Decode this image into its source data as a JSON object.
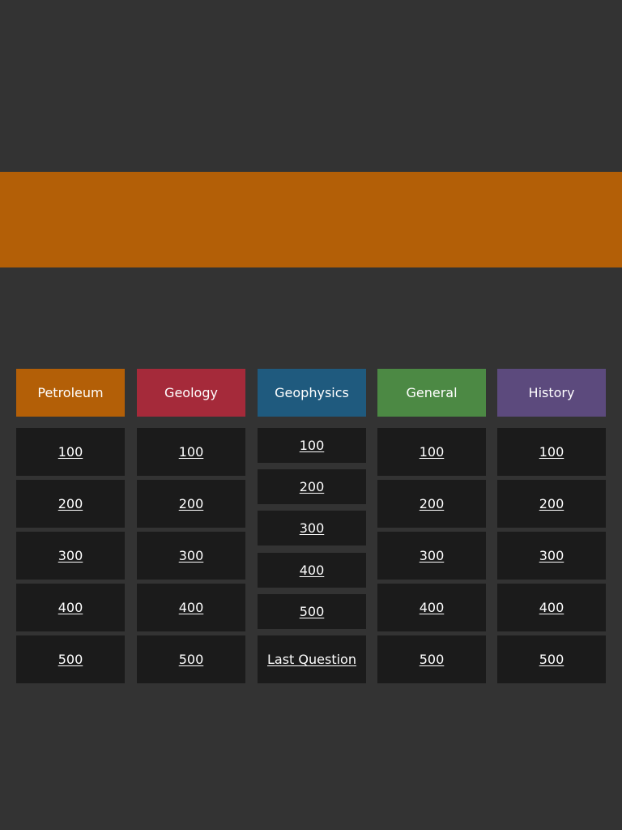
{
  "banner": {
    "color": "#B35F07"
  },
  "board": {
    "columns": [
      {
        "category": "Petroleum",
        "color": "#B35F07",
        "cells": [
          "100",
          "200",
          "300",
          "400",
          "500"
        ]
      },
      {
        "category": "Geology",
        "color": "#A52A3A",
        "cells": [
          "100",
          "200",
          "300",
          "400",
          "500"
        ]
      },
      {
        "category": "Geophysics",
        "color": "#1F5A7E",
        "cells": [
          "100",
          "200",
          "300",
          "400",
          "500",
          "Last Question"
        ]
      },
      {
        "category": "General",
        "color": "#4C8944",
        "cells": [
          "100",
          "200",
          "300",
          "400",
          "500"
        ]
      },
      {
        "category": "History",
        "color": "#5C4A7D",
        "cells": [
          "100",
          "200",
          "300",
          "400",
          "500"
        ]
      }
    ]
  }
}
